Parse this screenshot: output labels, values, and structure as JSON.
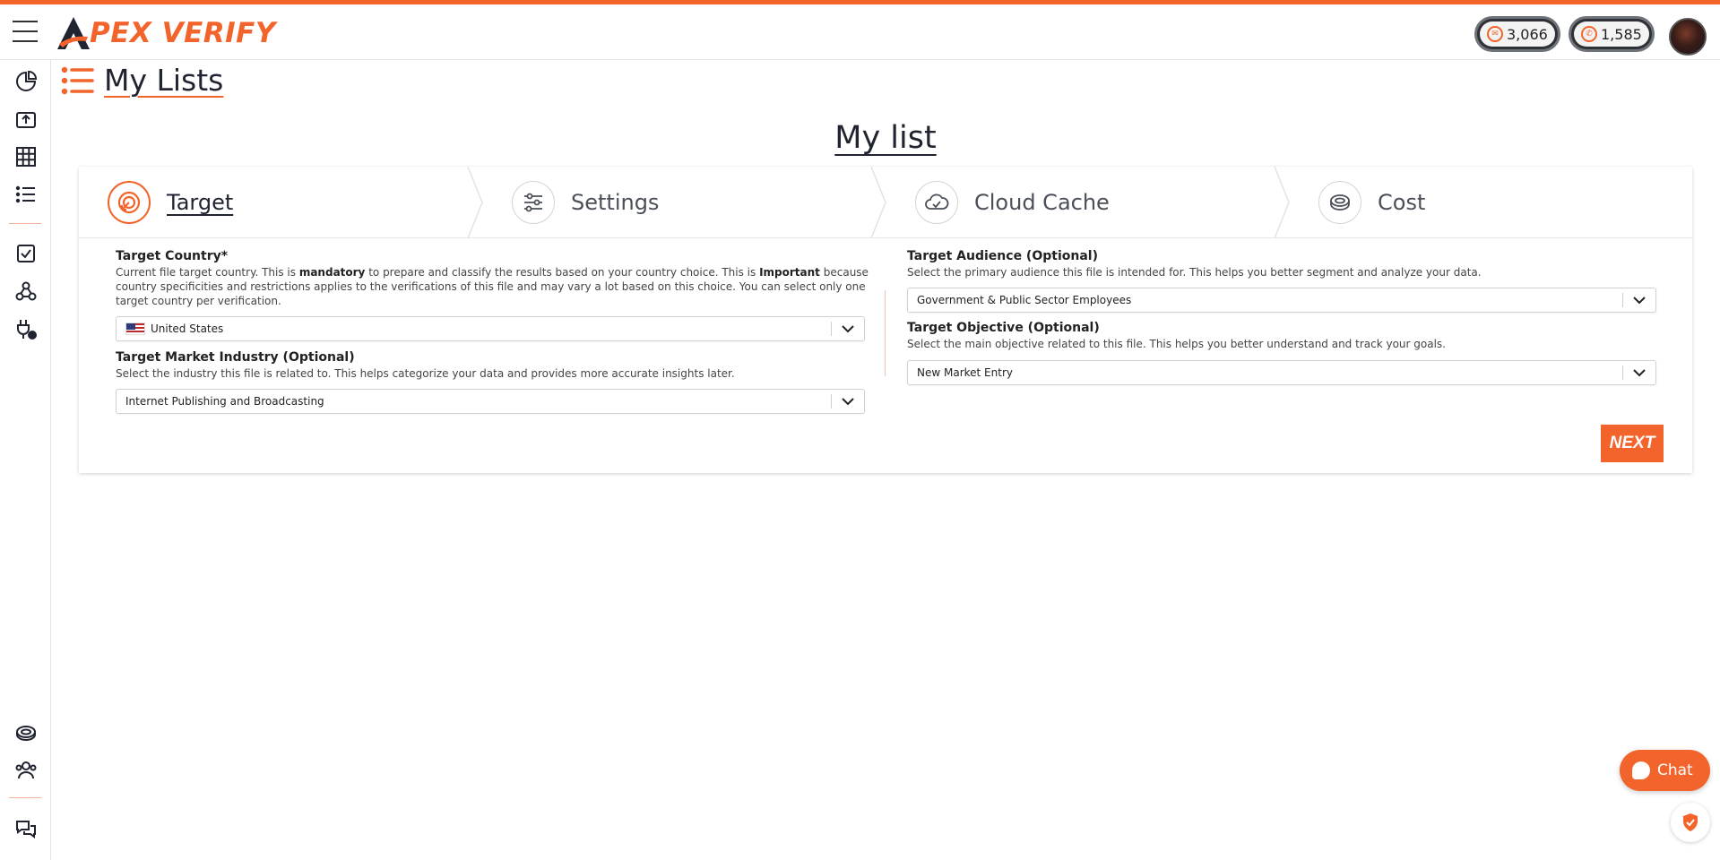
{
  "app": {
    "logo_text": "PEX VERIFY",
    "logo_letter": "A"
  },
  "header": {
    "credits_email": "3,066",
    "credits_phone": "1,585"
  },
  "page": {
    "title": "My Lists",
    "list_title": "My list"
  },
  "steps": [
    {
      "label": "Target",
      "icon": "target-icon",
      "active": true
    },
    {
      "label": "Settings",
      "icon": "sliders-icon",
      "active": false
    },
    {
      "label": "Cloud Cache",
      "icon": "cloud-icon",
      "active": false
    },
    {
      "label": "Cost",
      "icon": "coins-icon",
      "active": false
    }
  ],
  "form": {
    "country": {
      "title": "Target Country*",
      "desc_1": "Current file target country. This is ",
      "desc_bold_1": "mandatory",
      "desc_2": " to prepare and classify the results based on your country choice. This is ",
      "desc_bold_2": "Important",
      "desc_3": " because country specificities and restrictions applies to the verifications of this file and may vary a lot based on this choice. You can select only one target country per verification.",
      "value": "United States"
    },
    "industry": {
      "title": "Target Market Industry (Optional)",
      "desc": "Select the industry this file is related to. This helps categorize your data and provides more accurate insights later.",
      "value": "Internet Publishing and Broadcasting"
    },
    "audience": {
      "title": "Target Audience (Optional)",
      "desc": "Select the primary audience this file is intended for. This helps you better segment and analyze your data.",
      "value": "Government & Public Sector Employees"
    },
    "objective": {
      "title": "Target Objective (Optional)",
      "desc": "Select the main objective related to this file. This helps you better understand and track your goals.",
      "value": "New Market Entry"
    },
    "next_label": "NEXT"
  },
  "chat": {
    "label": "Chat"
  },
  "colors": {
    "accent": "#f2642c",
    "dark": "#1f2430"
  }
}
